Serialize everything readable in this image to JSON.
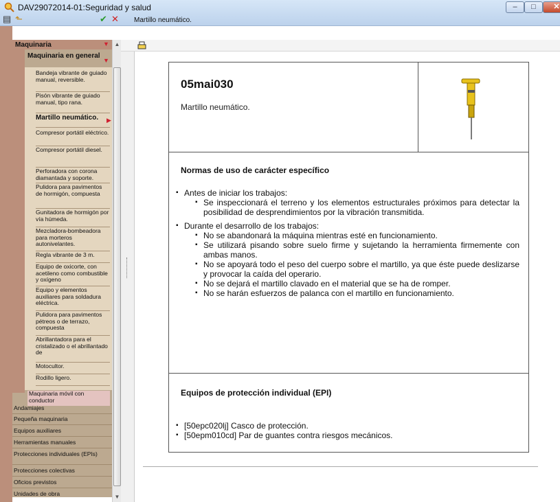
{
  "window": {
    "title": "DAV29072014-01:Seguridad y salud",
    "minimize": "–",
    "maximize": "□",
    "close": "✕"
  },
  "sidebar_toolbar": {
    "icon1": "▤",
    "icon2": "⬑",
    "check": "✔",
    "cross": "✕"
  },
  "right_header": "Martillo neumático.",
  "sidebar": {
    "root": "Maquinaria",
    "group": "Maquinaria en general",
    "items": [
      "Bandeja vibrante de guiado manual, reversible.",
      "Pisón vibrante de guiado manual, tipo rana.",
      "Martillo neumático.",
      "Compresor portátil eléctrico.",
      "Compresor portátil diesel.",
      "Perforadora con corona diamantada y soporte.",
      "Pulidora para pavimentos de hormigón, compuesta",
      "Gunitadora de hormigón por vía húmeda.",
      "Mezcladora-bombeadora para morteros autonivelantes.",
      "Regla vibrante de 3 m.",
      "Equipo de oxicorte, con acetileno como combustible y oxígeno",
      "Equipo y elementos auxiliares para soldadura eléctrica.",
      "Pulidora para pavimentos pétreos o de terrazo, compuesta",
      "Abrillantadora para el cristalizado o el abrillantado de",
      "Motocultor.",
      "Rodillo ligero."
    ],
    "group2": "Maquinaria móvil con conductor",
    "categories": [
      "Andamiajes",
      "Pequeña maquinaria",
      "Equipos auxiliares",
      "Herramientas manuales",
      "Protecciones individuales (EPIs)",
      "Protecciones colectivas",
      "Oficios previstos",
      "Unidades de obra"
    ]
  },
  "doc": {
    "code": "05mai030",
    "description": "Martillo neumático.",
    "section1": "Normas de uso de carácter específico",
    "before_header": "Antes de iniciar los trabajos:",
    "before_items": [
      "Se inspeccionará el terreno y los elementos estructurales próximos para detectar la posibilidad de desprendimientos por la vibración transmitida."
    ],
    "during_header": "Durante el desarrollo de los trabajos:",
    "during_items": [
      "No se abandonará la máquina mientras esté en funcionamiento.",
      "Se utilizará pisando sobre suelo firme y sujetando la herramienta firmemente con ambas manos.",
      "No se apoyará todo el peso del cuerpo sobre el martillo, ya que éste puede deslizarse y provocar la caída del operario.",
      "No se dejará el martillo clavado en el material que se ha de romper.",
      "No se harán esfuerzos de palanca con el martillo en funcionamiento."
    ],
    "section2": "Equipos de protección individual (EPI)",
    "epi_items": [
      "[50epc020lj] Casco de protección.",
      "[50epm010cd] Par de guantes contra riesgos mecánicos."
    ]
  }
}
